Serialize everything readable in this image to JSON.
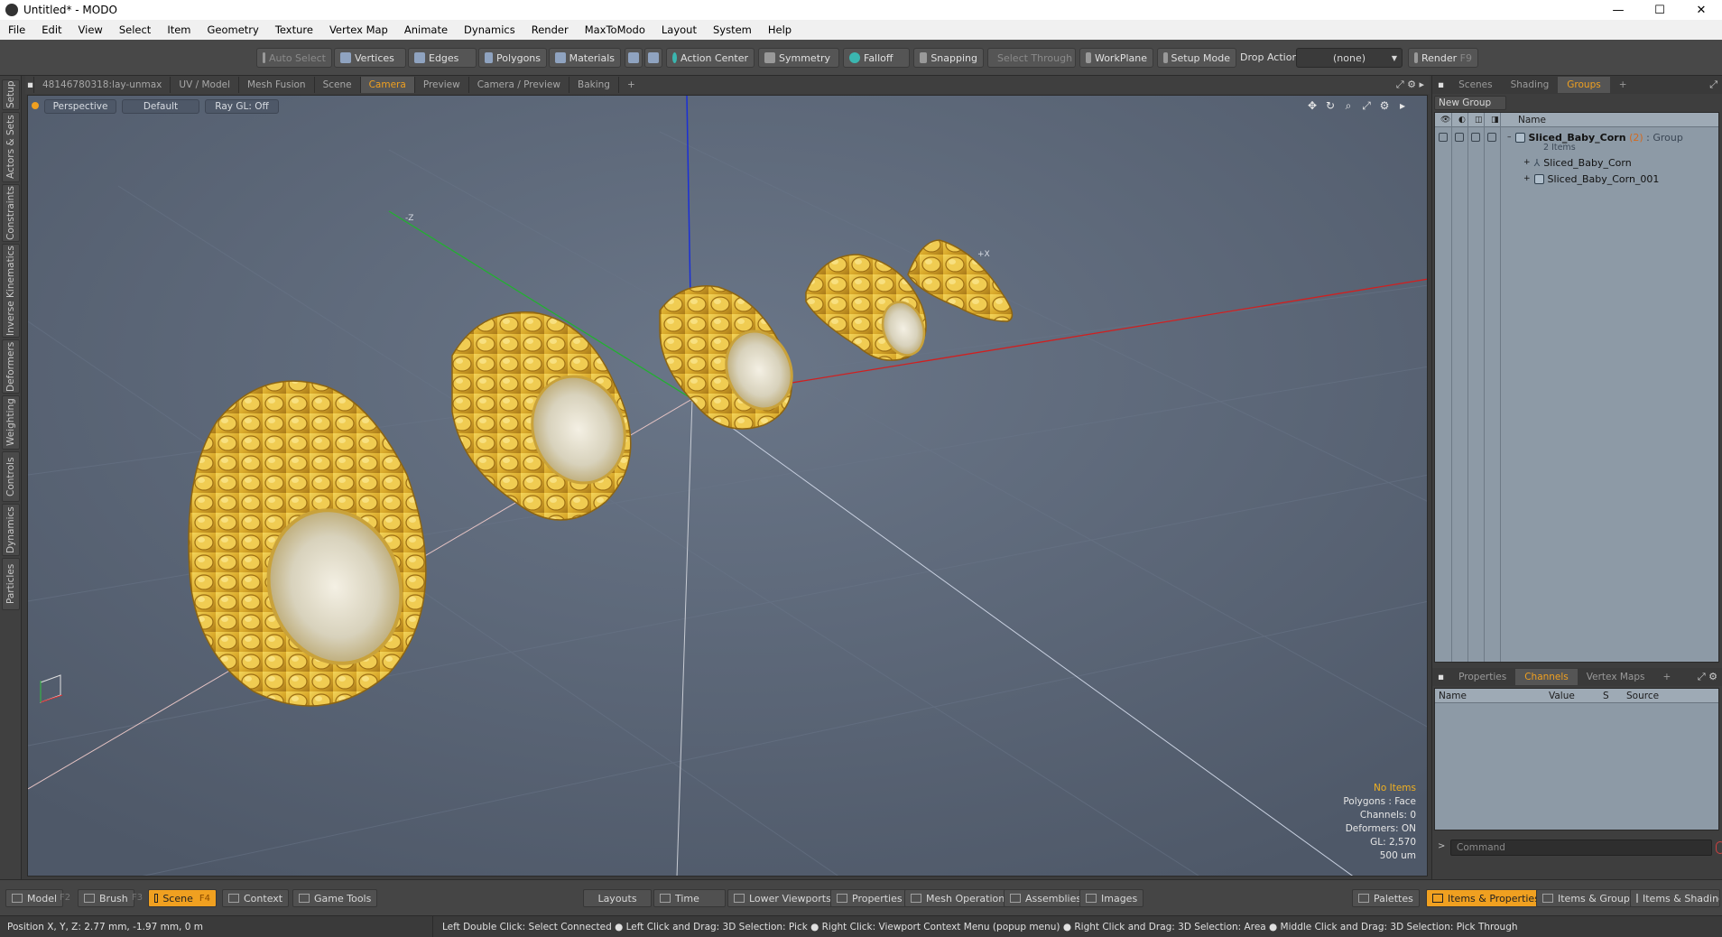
{
  "window": {
    "title": "Untitled* - MODO",
    "min": "—",
    "max": "☐",
    "close": "✕"
  },
  "menu": [
    "File",
    "Edit",
    "View",
    "Select",
    "Item",
    "Geometry",
    "Texture",
    "Vertex Map",
    "Animate",
    "Dynamics",
    "Render",
    "MaxToModo",
    "Layout",
    "System",
    "Help"
  ],
  "toolbar": {
    "auto_select": "Auto Select",
    "vertices": "Vertices",
    "edges": "Edges",
    "polygons": "Polygons",
    "materials": "Materials",
    "action_center": "Action Center",
    "symmetry": "Symmetry",
    "falloff": "Falloff",
    "snapping": "Snapping",
    "select_through": "Select Through",
    "workplane": "WorkPlane",
    "setup_mode": "Setup Mode",
    "drop_action": "Drop Action",
    "drop_value": "(none)",
    "render": "Render",
    "render_key": "F9"
  },
  "left_tabs": [
    "Setup",
    "Actors & Sets",
    "Constraints",
    "Inverse Kinematics",
    "Deformers",
    "Weighting",
    "Controls",
    "Dynamics",
    "Particles"
  ],
  "viewport_tabs": [
    "48146780318:lay-unmax",
    "UV / Model",
    "Mesh Fusion",
    "Scene",
    "Camera",
    "Preview",
    "Camera / Preview",
    "Baking",
    "+"
  ],
  "viewport_header": {
    "view": "Perspective",
    "shading": "Default",
    "raygl": "Ray GL: Off"
  },
  "axis_labels": {
    "neg_z": "-Z",
    "pos_x": "+X"
  },
  "stats": {
    "items": "No Items",
    "polygons": "Polygons : Face",
    "channels": "Channels: 0",
    "deformers": "Deformers: ON",
    "gl": "GL: 2,570",
    "scale": "500 um"
  },
  "right_panel": {
    "top_tabs": [
      "Scenes",
      "Shading",
      "Groups",
      "+"
    ],
    "new_group": "New Group",
    "col_name": "Name",
    "group": {
      "name": "Sliced_Baby_Corn",
      "count": "(2)",
      "type": ": Group",
      "items": "2 Items"
    },
    "children": [
      "Sliced_Baby_Corn",
      "Sliced_Baby_Corn_001"
    ],
    "bottom_tabs": [
      "Properties",
      "Channels",
      "Vertex Maps",
      "+"
    ],
    "chan_cols": [
      "Name",
      "Value",
      "S",
      "Source"
    ],
    "command_placeholder": "Command"
  },
  "bottom_bar": {
    "model": "Model",
    "model_key": "F2",
    "brush": "Brush",
    "brush_key": "F3",
    "scene": "Scene",
    "scene_key": "F4",
    "context": "Context",
    "game_tools": "Game Tools",
    "layouts": "Layouts",
    "time": "Time",
    "lower_viewports": "Lower Viewports",
    "properties": "Properties",
    "mesh_operations": "Mesh Operations",
    "assemblies": "Assemblies",
    "images": "Images",
    "palettes": "Palettes",
    "items_properties": "Items & Properties",
    "items_groups": "Items & Groups",
    "items_shading": "Items & Shading"
  },
  "status": {
    "position": "Position X, Y, Z:   2.77 mm, -1.97 mm, 0 m",
    "hints": "Left Double Click: Select Connected ● Left Click and Drag: 3D Selection: Pick ● Right Click: Viewport Context Menu (popup menu) ● Right Click and Drag: 3D Selection: Area ● Middle Click and Drag: 3D Selection: Pick Through"
  },
  "colors": {
    "accent": "#f0a020",
    "viewport_bg": "#5b6778",
    "corn": "#e0b830"
  }
}
